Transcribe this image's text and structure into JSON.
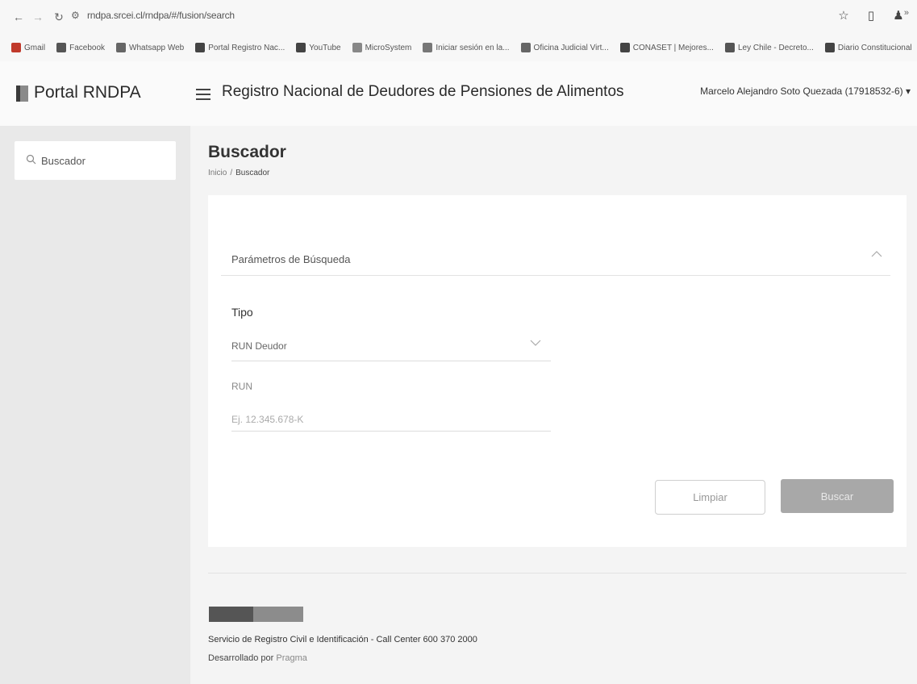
{
  "browser": {
    "url": "rndpa.srcei.cl/rndpa/#/fusion/search",
    "bookmarks": [
      {
        "label": "Gmail",
        "icon": "gmail-icon",
        "color": "#c0392b"
      },
      {
        "label": "Facebook",
        "icon": "facebook-icon",
        "color": "#555555"
      },
      {
        "label": "Whatsapp Web",
        "icon": "whatsapp-icon",
        "color": "#666666"
      },
      {
        "label": "Portal Registro Nac...",
        "icon": "portal-icon",
        "color": "#444444"
      },
      {
        "label": "YouTube",
        "icon": "youtube-icon",
        "color": "#444444"
      },
      {
        "label": "MicroSystem",
        "icon": "microsystem-icon",
        "color": "#888888"
      },
      {
        "label": "Iniciar sesión en la...",
        "icon": "microsoft-icon",
        "color": "#777777"
      },
      {
        "label": "Oficina Judicial Virt...",
        "icon": "judicial-icon",
        "color": "#666666"
      },
      {
        "label": "CONASET | Mejores...",
        "icon": "conaset-icon",
        "color": "#444444"
      },
      {
        "label": "Ley Chile - Decreto...",
        "icon": "leychile-icon",
        "color": "#555555"
      },
      {
        "label": "Diario Constitucional",
        "icon": "diario-icon",
        "color": "#444444"
      }
    ]
  },
  "header": {
    "logo_text": "Portal RNDPA",
    "title": "Registro Nacional de Deudores de Pensiones de Alimentos",
    "user": "Marcelo Alejandro Soto Quezada (17918532-6)"
  },
  "sidebar": {
    "items": [
      {
        "label": "Buscador",
        "icon": "search-icon"
      }
    ]
  },
  "main": {
    "title": "Buscador",
    "breadcrumb": {
      "home": "Inicio",
      "separator": "/",
      "current": "Buscador"
    },
    "panel_title": "Parámetros de Búsqueda",
    "tipo_label": "Tipo",
    "tipo_value": "RUN Deudor",
    "run_label": "RUN",
    "run_placeholder": "Ej. 12.345.678-K",
    "clear_label": "Limpiar",
    "search_label": "Buscar"
  },
  "footer": {
    "line1": "Servicio de Registro Civil e Identificación - Call Center 600 370 2000",
    "line2_prefix": "Desarrollado por",
    "line2_link": "Pragma"
  }
}
